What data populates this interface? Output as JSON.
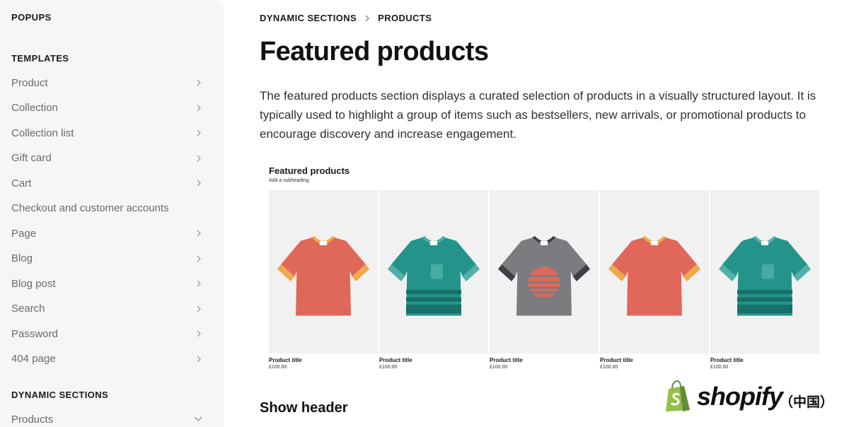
{
  "sidebar": {
    "popups_heading": "POPUPS",
    "templates_heading": "TEMPLATES",
    "items": [
      {
        "label": "Product",
        "chevron": "right"
      },
      {
        "label": "Collection",
        "chevron": "right"
      },
      {
        "label": "Collection list",
        "chevron": "right"
      },
      {
        "label": "Gift card",
        "chevron": "right"
      },
      {
        "label": "Cart",
        "chevron": "right"
      },
      {
        "label": "Checkout and customer accounts",
        "chevron": "none"
      },
      {
        "label": "Page",
        "chevron": "right"
      },
      {
        "label": "Blog",
        "chevron": "right"
      },
      {
        "label": "Blog post",
        "chevron": "right"
      },
      {
        "label": "Search",
        "chevron": "right"
      },
      {
        "label": "Password",
        "chevron": "right"
      },
      {
        "label": "404 page",
        "chevron": "right"
      }
    ],
    "dynamic_heading": "DYNAMIC SECTIONS",
    "dynamic_items": [
      {
        "label": "Products",
        "chevron": "down"
      }
    ]
  },
  "breadcrumb": {
    "parent": "DYNAMIC SECTIONS",
    "current": "PRODUCTS",
    "separator_icon": "chevron-right-icon"
  },
  "page": {
    "title": "Featured products",
    "description": "The featured products section displays a curated selection of products in a visually structured layout. It is typically used to highlight a group of items such as bestsellers, new arrivals, or promotional products to encourage discovery and increase engagement.",
    "next_heading": "Show header"
  },
  "preview": {
    "title": "Featured products",
    "subheading": "Add a subheading.",
    "products": [
      {
        "title": "Product title",
        "price": "£100.00",
        "shirt": "coral"
      },
      {
        "title": "Product title",
        "price": "£100.00",
        "shirt": "teal"
      },
      {
        "title": "Product title",
        "price": "£100.00",
        "shirt": "gray"
      },
      {
        "title": "Product title",
        "price": "£100.00",
        "shirt": "coral"
      },
      {
        "title": "Product title",
        "price": "£100.00",
        "shirt": "teal"
      }
    ]
  },
  "watermark": {
    "brand": "shopify",
    "region": "（中国）"
  },
  "colors": {
    "coral": "#e0685a",
    "coral_trim": "#f0a94b",
    "teal": "#24948a",
    "teal_dark": "#17706a",
    "teal_light": "#4fb1a8",
    "gray": "#7a7c80",
    "gray_dark": "#3f4045",
    "shopify_green": "#95bf47"
  }
}
